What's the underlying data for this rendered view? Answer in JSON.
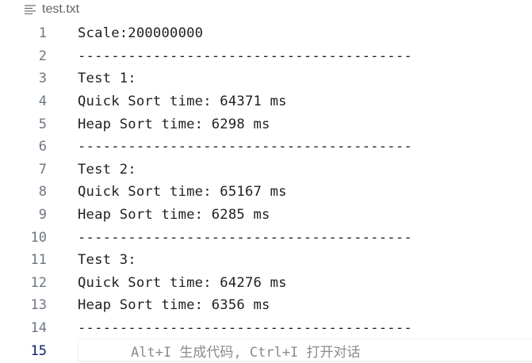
{
  "tab": {
    "filename": "test.txt",
    "icon": "file-lines-icon"
  },
  "lines": [
    {
      "number": "1",
      "text": "Scale:200000000"
    },
    {
      "number": "2",
      "text": "----------------------------------------"
    },
    {
      "number": "3",
      "text": "Test 1:"
    },
    {
      "number": "4",
      "text": "Quick Sort time: 64371 ms"
    },
    {
      "number": "5",
      "text": "Heap Sort time: 6298 ms"
    },
    {
      "number": "6",
      "text": "----------------------------------------"
    },
    {
      "number": "7",
      "text": "Test 2:"
    },
    {
      "number": "8",
      "text": "Quick Sort time: 65167 ms"
    },
    {
      "number": "9",
      "text": "Heap Sort time: 6285 ms"
    },
    {
      "number": "10",
      "text": "----------------------------------------"
    },
    {
      "number": "11",
      "text": "Test 3:"
    },
    {
      "number": "12",
      "text": "Quick Sort time: 64276 ms"
    },
    {
      "number": "13",
      "text": "Heap Sort time: 6356 ms"
    },
    {
      "number": "14",
      "text": "----------------------------------------"
    },
    {
      "number": "15",
      "text": ""
    }
  ],
  "inline_hint": "Alt+I 生成代码, Ctrl+I 打开对话",
  "colors": {
    "active_line_number": "#0b216f",
    "line_number": "#6e7681",
    "text": "#1f1f1f",
    "hint": "#8b8b8b"
  }
}
